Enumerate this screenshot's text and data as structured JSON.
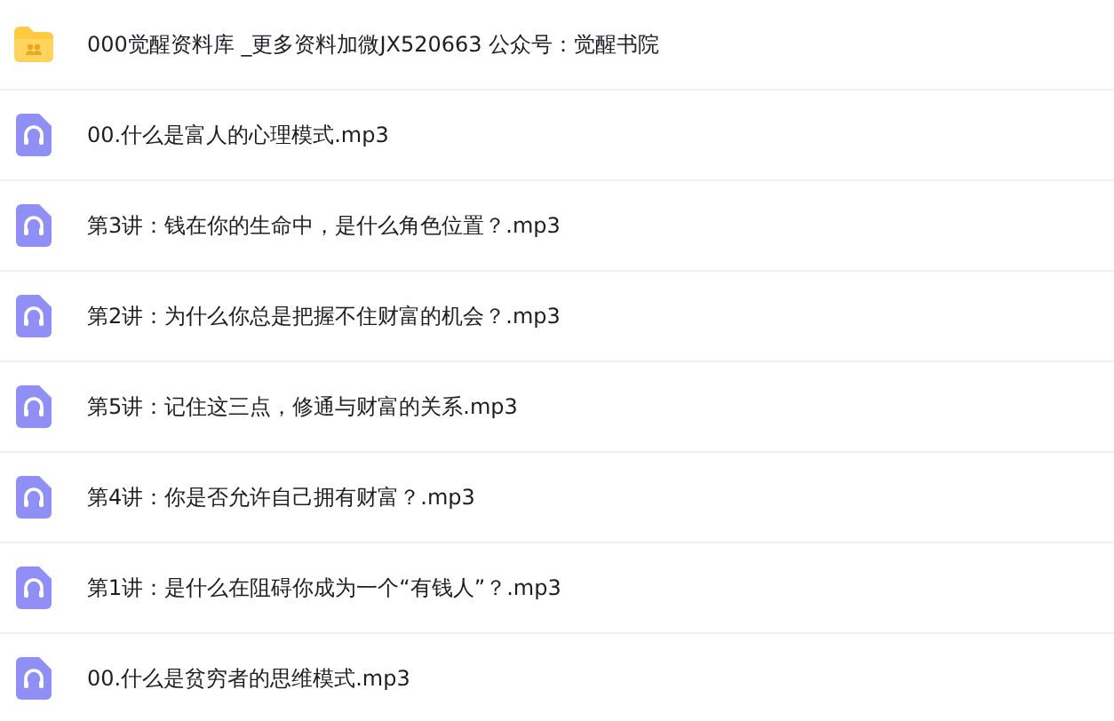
{
  "files": [
    {
      "kind": "folder",
      "name": "000觉醒资料库 _更多资料加微JX520663 公众号：觉醒书院"
    },
    {
      "kind": "audio",
      "name": "00.什么是富人的心理模式.mp3"
    },
    {
      "kind": "audio",
      "name": "第3讲：钱在你的生命中，是什么角色位置？.mp3"
    },
    {
      "kind": "audio",
      "name": "第2讲：为什么你总是把握不住财富的机会？.mp3"
    },
    {
      "kind": "audio",
      "name": "第5讲：记住这三点，修通与财富的关系.mp3"
    },
    {
      "kind": "audio",
      "name": "第4讲：你是否允许自己拥有财富？.mp3"
    },
    {
      "kind": "audio",
      "name": "第1讲：是什么在阻碍你成为一个“有钱人”？.mp3"
    },
    {
      "kind": "audio",
      "name": "00.什么是贫穷者的思维模式.mp3"
    }
  ]
}
